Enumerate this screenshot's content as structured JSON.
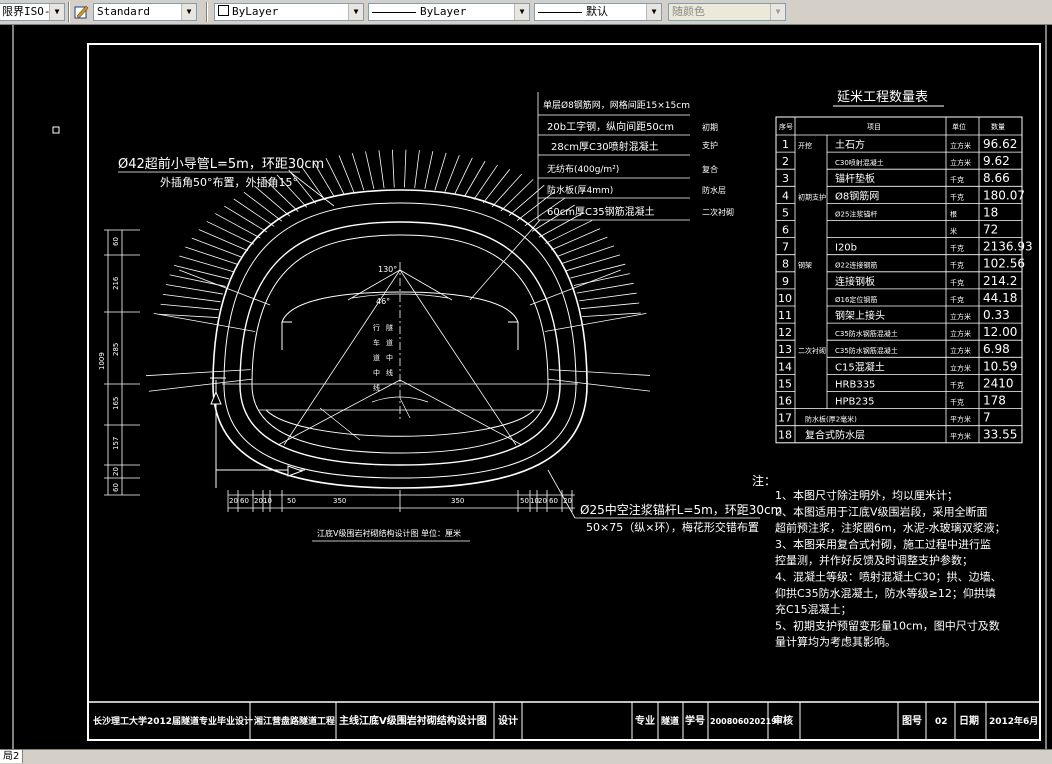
{
  "toolbar": {
    "dimstyle": "ISO-",
    "dimstyle_prefix": "限界",
    "textstyle": "Standard",
    "layer": "ByLayer",
    "linetype": "ByLayer",
    "lineweight": "默认",
    "plotstyle": "随颜色"
  },
  "tabs": {
    "active": "局2"
  },
  "drawing": {
    "title_qty": "延米工程数量表",
    "header_cols": [
      "序号",
      "项目",
      "单位",
      "数量"
    ],
    "rows": [
      {
        "no": "1",
        "name": "开挖",
        "item": "土石方",
        "unit": "立方米",
        "qty": "96.62"
      },
      {
        "no": "2",
        "name": "",
        "item": "C30喷射混凝土",
        "unit": "立方米",
        "qty": "9.62"
      },
      {
        "no": "3",
        "name": "",
        "item": "锚杆垫板",
        "unit": "千克",
        "qty": "8.66"
      },
      {
        "no": "4",
        "name": "初期支护",
        "item": "Ø8钢筋网",
        "unit": "千克",
        "qty": "180.07"
      },
      {
        "no": "5",
        "name": "",
        "item": "Ø25注浆锚杆",
        "unit": "根",
        "qty": "18"
      },
      {
        "no": "6",
        "name": "",
        "item": "",
        "unit": "米",
        "qty": "72"
      },
      {
        "no": "7",
        "name": "",
        "item": "I20b",
        "unit": "千克",
        "qty": "2136.93"
      },
      {
        "no": "8",
        "name": "钢架",
        "item": "Ø22连接钢筋",
        "unit": "千克",
        "qty": "102.56"
      },
      {
        "no": "9",
        "name": "",
        "item": "连接钢板",
        "unit": "千克",
        "qty": "214.2"
      },
      {
        "no": "10",
        "name": "",
        "item": "Ø16定位钢筋",
        "unit": "千克",
        "qty": "44.18"
      },
      {
        "no": "11",
        "name": "",
        "item": "钢架上接头",
        "unit": "立方米",
        "qty": "0.33"
      },
      {
        "no": "12",
        "name": "",
        "item": "C35防水钢筋混凝土",
        "unit": "立方米",
        "qty": "12.00"
      },
      {
        "no": "13",
        "name": "二次衬砌",
        "item": "C35防水钢筋混凝土",
        "unit": "立方米",
        "qty": "6.98"
      },
      {
        "no": "14",
        "name": "",
        "item": "C15混凝土",
        "unit": "立方米",
        "qty": "10.59"
      },
      {
        "no": "15",
        "name": "",
        "item": "HRB335",
        "unit": "千克",
        "qty": "2410"
      },
      {
        "no": "16",
        "name": "",
        "item": "HPB235",
        "unit": "千克",
        "qty": "178"
      },
      {
        "no": "17",
        "name": "",
        "item": "防水板(厚2毫米)",
        "unit": "平方米",
        "qty": "7"
      },
      {
        "no": "18",
        "name": "",
        "item": "复合式防水层",
        "unit": "平方米",
        "qty": "33.55"
      }
    ],
    "legend_lines": [
      "单层Ø8钢筋网，网格间距15×15cm",
      "20b工字钢，纵向间距50cm",
      "28cm厚C30喷射混凝土",
      "无纺布(400g/m²)",
      "防水板(厚4mm)",
      "60cm厚C35钢筋混凝土"
    ],
    "legend_right": [
      "初期",
      "支护",
      "复合",
      "防水层",
      "二次衬砌"
    ],
    "left_anno_1": "Ø42超前小导管L=5m，环距30cm",
    "left_anno_2": "外插角50°布置，外插角15°",
    "right_anno_1": "Ø25中空注浆锚杆L=5m，环距30cm",
    "right_anno_2": "50×75（纵×环），梅花形交错布置",
    "dim_bottom": [
      "20",
      "60",
      "20",
      "10",
      "50",
      "350",
      "350",
      "50",
      "10",
      "20",
      "60",
      "20"
    ],
    "dim_left": [
      "60",
      "216",
      "285",
      "1009",
      "165",
      "157",
      "20",
      "60"
    ],
    "angle_top": "130°",
    "angle_mid": "46°",
    "fig_caption": "江底V级围岩衬砌结构设计图   单位：厘米",
    "notes_title": "注：",
    "notes": [
      "1、本图尺寸除注明外，均以厘米计；",
      "2、本图适用于江底V级围岩段，采用全断面",
      "超前预注浆，注浆圈6m，水泥-水玻璃双浆液；",
      "3、本图采用复合式衬砌，施工过程中进行监",
      "控量测，并作好反馈及时调整支护参数；",
      "4、混凝土等级：喷射混凝土C30；拱、边墙、",
      "仰拱C35防水混凝土，防水等级≥12；仰拱填",
      "充C15混凝土；",
      "5、初期支护预留变形量10cm，图中尺寸及数",
      "量计算均为考虑其影响。"
    ],
    "titleblock": {
      "school": "长沙理工大学2012届隧道专业毕业设计",
      "project": "湘江营盘路隧道工程",
      "drawing": "主线江底Ⅴ级围岩衬砌结构设计图",
      "design_label": "设计",
      "major_label": "专业",
      "major": "隧道",
      "id_label": "学号",
      "id": "200806020219",
      "review_label": "审核",
      "no_label": "图号",
      "no": "02",
      "date_label": "日期",
      "date": "2012年6月"
    }
  }
}
